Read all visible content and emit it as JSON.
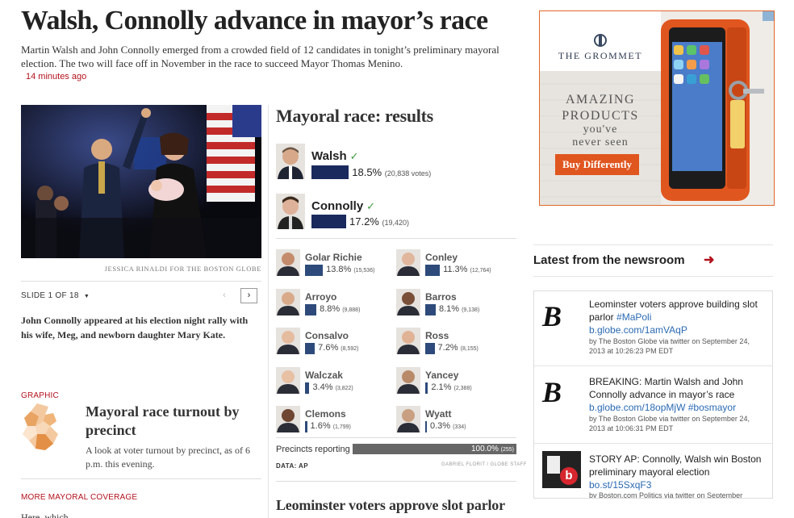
{
  "article": {
    "headline": "Walsh, Connolly advance in mayor’s race",
    "dek": "Martin Walsh and John Connolly emerged from a crowded field of 12 candidates in tonight’s preliminary mayoral election. The two will face off in November in the race to succeed Mayor Thomas Menino.",
    "timestamp": "14 minutes ago"
  },
  "slideshow": {
    "credit": "JESSICA RINALDI FOR THE BOSTON GLOBE",
    "slide_label": "SLIDE 1 OF 18",
    "prev_icon": "‹",
    "next_icon": "›",
    "caption": "John Connolly appeared at his election night rally with his wife, Meg, and newborn daughter Mary Kate."
  },
  "graphic": {
    "kicker": "GRAPHIC",
    "title": "Mayoral race turnout by precinct",
    "description": "A look at voter turnout by precinct, as of 6 p.m. this evening."
  },
  "more_coverage": {
    "kicker": "MORE MAYORAL COVERAGE",
    "first_item": "Here, which..."
  },
  "results": {
    "title": "Mayoral race: results",
    "check_icon": "✓",
    "leaders": [
      {
        "name": "Walsh",
        "pct": "18.5%",
        "votes": "(20,838 votes)",
        "value": 18.5
      },
      {
        "name": "Connolly",
        "pct": "17.2%",
        "votes": "(19,420)",
        "value": 17.2
      }
    ],
    "others": [
      {
        "name": "Golar Richie",
        "pct": "13.8%",
        "votes": "(15,536)",
        "value": 13.8
      },
      {
        "name": "Conley",
        "pct": "11.3%",
        "votes": "(12,764)",
        "value": 11.3
      },
      {
        "name": "Arroyo",
        "pct": "8.8%",
        "votes": "(9,888)",
        "value": 8.8
      },
      {
        "name": "Barros",
        "pct": "8.1%",
        "votes": "(9,138)",
        "value": 8.1
      },
      {
        "name": "Consalvo",
        "pct": "7.6%",
        "votes": "(8,592)",
        "value": 7.6
      },
      {
        "name": "Ross",
        "pct": "7.2%",
        "votes": "(8,155)",
        "value": 7.2
      },
      {
        "name": "Walczak",
        "pct": "3.4%",
        "votes": "(3,822)",
        "value": 3.4
      },
      {
        "name": "Yancey",
        "pct": "2.1%",
        "votes": "(2,388)",
        "value": 2.1
      },
      {
        "name": "Clemons",
        "pct": "1.6%",
        "votes": "(1,799)",
        "value": 1.6
      },
      {
        "name": "Wyatt",
        "pct": "0.3%",
        "votes": "(334)",
        "value": 0.3
      }
    ],
    "precincts_label": "Precincts reporting",
    "precincts_value": "100.0%",
    "precincts_count": "(255)",
    "precincts_fraction": 1.0,
    "data_source": "DATA: AP",
    "chart_credit": "GABRIEL FLORIT / GLOBE STAFF"
  },
  "next_story": {
    "headline": "Leominster voters approve slot parlor"
  },
  "ad": {
    "brand": "THE GROMMET",
    "line1": "AMAZING",
    "line2": "PRODUCTS",
    "line3": "you've",
    "line4": "never seen",
    "cta": "Buy Differently",
    "accent": "#e0672b"
  },
  "newsroom": {
    "title": "Latest from the newsroom",
    "arrow_icon": "➜",
    "items": [
      {
        "logo": "B",
        "text": "Leominster voters approve building slot parlor",
        "hashtag": "#MaPoli",
        "link": "b.globe.com/1amVAqP",
        "meta": "by The Boston Globe via twitter on September 24, 2013 at 10:26:23 PM EDT"
      },
      {
        "logo": "B",
        "text": "BREAKING: Martin Walsh and John Connolly advance in mayor’s race",
        "hashtag": "",
        "link": "b.globe.com/18opMjW #bosmayor",
        "meta": "by The Boston Globe via twitter on September 24, 2013 at 10:06:31 PM EDT"
      },
      {
        "logo": "b",
        "text": "STORY AP: Connolly, Walsh win Boston preliminary mayoral election",
        "hashtag": "",
        "link": "bo.st/15SxqF3",
        "meta": "by Boston.com Politics via twitter on September"
      }
    ]
  }
}
